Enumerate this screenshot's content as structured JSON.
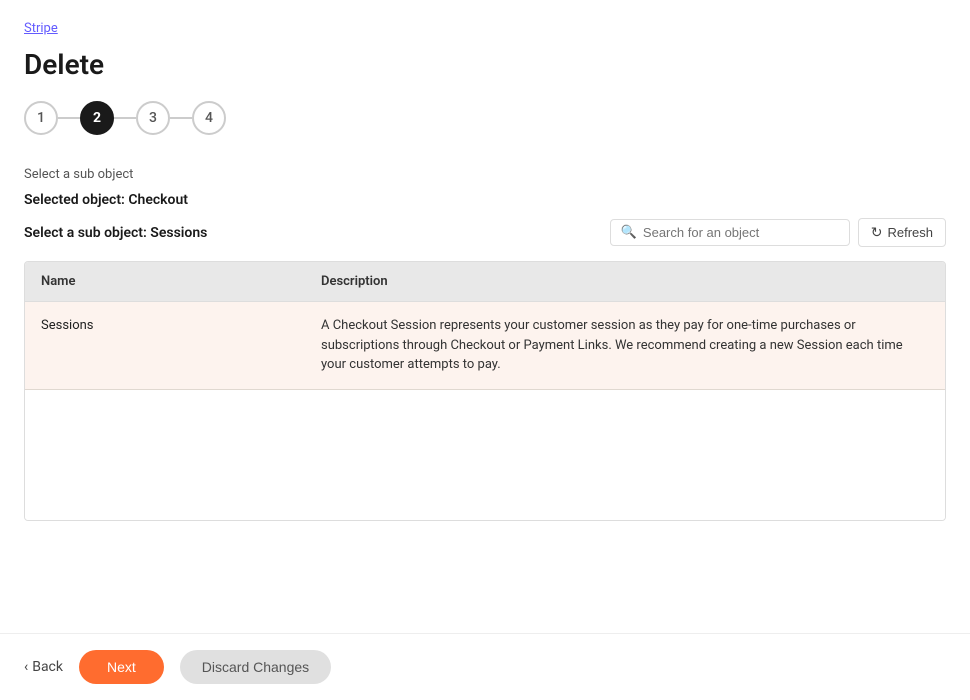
{
  "breadcrumb": {
    "label": "Stripe"
  },
  "page": {
    "title": "Delete"
  },
  "stepper": {
    "steps": [
      {
        "number": "1",
        "active": false
      },
      {
        "number": "2",
        "active": true
      },
      {
        "number": "3",
        "active": false
      },
      {
        "number": "4",
        "active": false
      }
    ]
  },
  "section": {
    "label": "Select a sub object",
    "selected_object_label": "Selected object: Checkout",
    "sub_object_title": "Select a sub object: Sessions"
  },
  "search": {
    "placeholder": "Search for an object"
  },
  "refresh_button": {
    "label": "Refresh"
  },
  "table": {
    "columns": [
      "Name",
      "Description"
    ],
    "rows": [
      {
        "name": "Sessions",
        "description": "A Checkout Session represents your customer session as they pay for one-time purchases or subscriptions through Checkout or Payment Links. We recommend creating a new Session each time your customer attempts to pay.",
        "selected": true
      }
    ]
  },
  "actions": {
    "back_label": "Back",
    "next_label": "Next",
    "discard_label": "Discard Changes"
  }
}
